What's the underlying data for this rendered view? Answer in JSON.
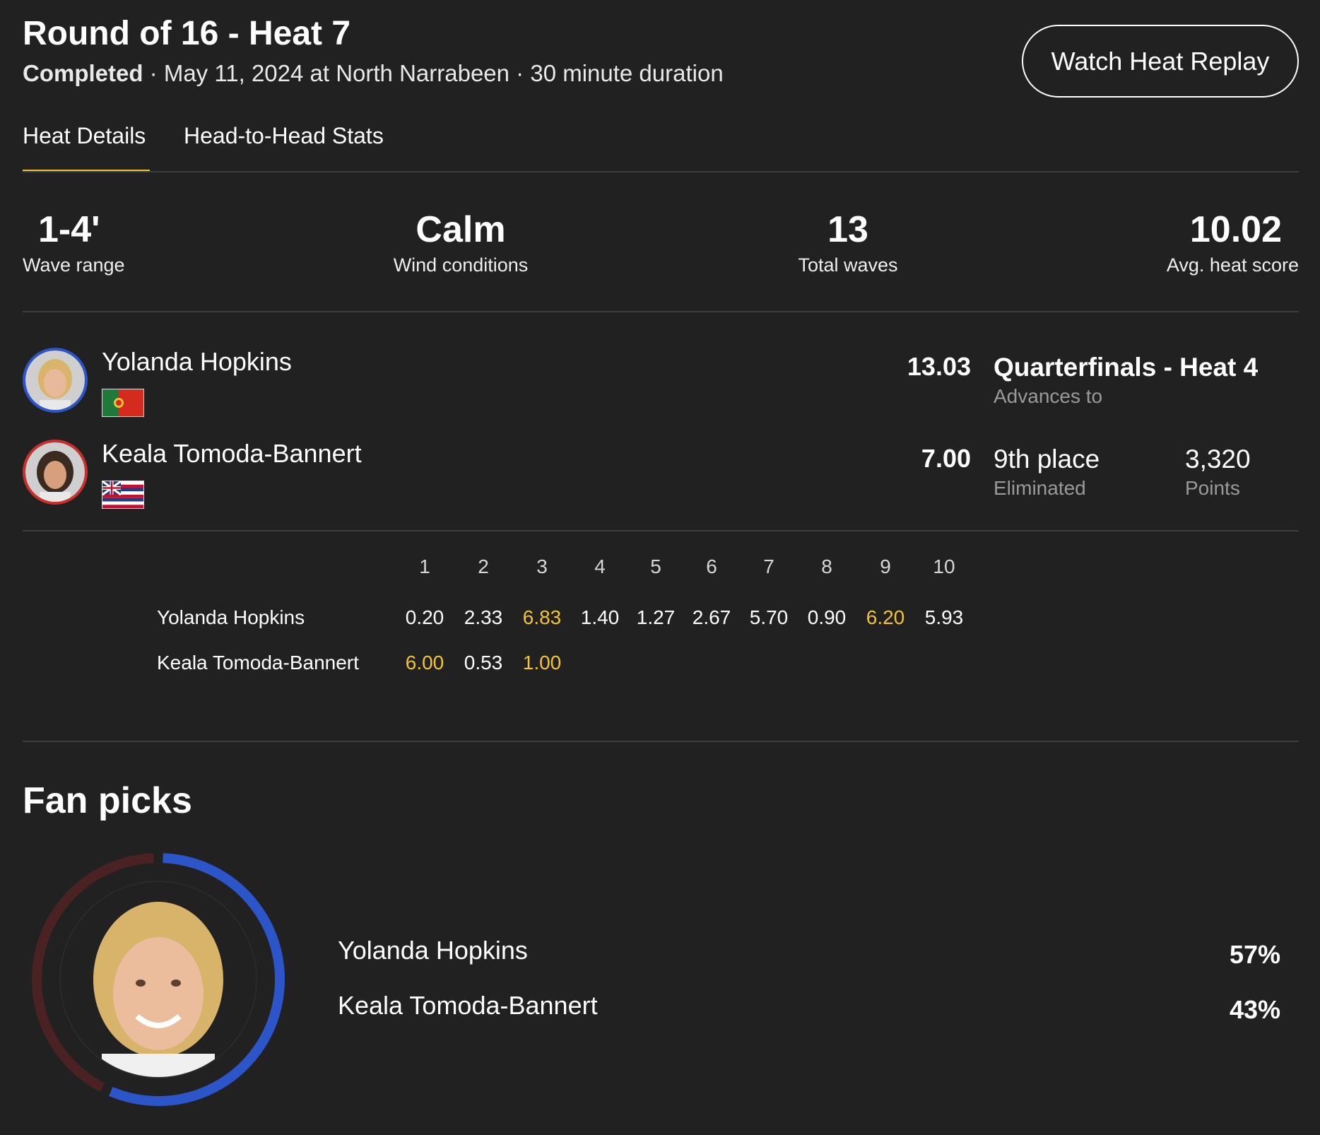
{
  "header": {
    "title": "Round of 16 - Heat 7",
    "status": "Completed",
    "details": " · May 11, 2024 at North Narrabeen · 30 minute duration",
    "replay_button": "Watch Heat Replay"
  },
  "tabs": [
    {
      "label": "Heat Details",
      "active": true
    },
    {
      "label": "Head-to-Head Stats",
      "active": false
    }
  ],
  "stats": [
    {
      "value": "1-4'",
      "label": "Wave range"
    },
    {
      "value": "Calm",
      "label": "Wind conditions"
    },
    {
      "value": "13",
      "label": "Total waves"
    },
    {
      "value": "10.02",
      "label": "Avg. heat score"
    }
  ],
  "athletes": [
    {
      "name": "Yolanda Hopkins",
      "flag_icon": "portugal-flag-icon",
      "ring_color": "#2b55c9",
      "score": "13.03",
      "result": "Quarterfinals - Heat 4",
      "result_sub": "Advances to",
      "points": null,
      "points_label": null
    },
    {
      "name": "Keala Tomoda-Bannert",
      "flag_icon": "hawaii-flag-icon",
      "ring_color": "#c9302b",
      "score": "7.00",
      "result": "9th place",
      "result_sub": "Eliminated",
      "points": "3,320",
      "points_label": "Points"
    }
  ],
  "waves": {
    "headers": [
      "1",
      "2",
      "3",
      "4",
      "5",
      "6",
      "7",
      "8",
      "9",
      "10"
    ],
    "rows": [
      {
        "name": "Yolanda Hopkins",
        "scores": [
          "0.20",
          "2.33",
          "6.83",
          "1.40",
          "1.27",
          "2.67",
          "5.70",
          "0.90",
          "6.20",
          "5.93"
        ],
        "counting": [
          2,
          8
        ]
      },
      {
        "name": "Keala Tomoda-Bannert",
        "scores": [
          "6.00",
          "0.53",
          "1.00"
        ],
        "counting": [
          0,
          2
        ]
      }
    ],
    "highlight_color": "#f2c335"
  },
  "fan_picks": {
    "title": "Fan picks",
    "picks": [
      {
        "name": "Yolanda Hopkins",
        "percent": "57%",
        "value": 57,
        "color": "#2b55c9"
      },
      {
        "name": "Keala Tomoda-Bannert",
        "percent": "43%",
        "value": 43,
        "color": "#4a2223"
      }
    ]
  }
}
